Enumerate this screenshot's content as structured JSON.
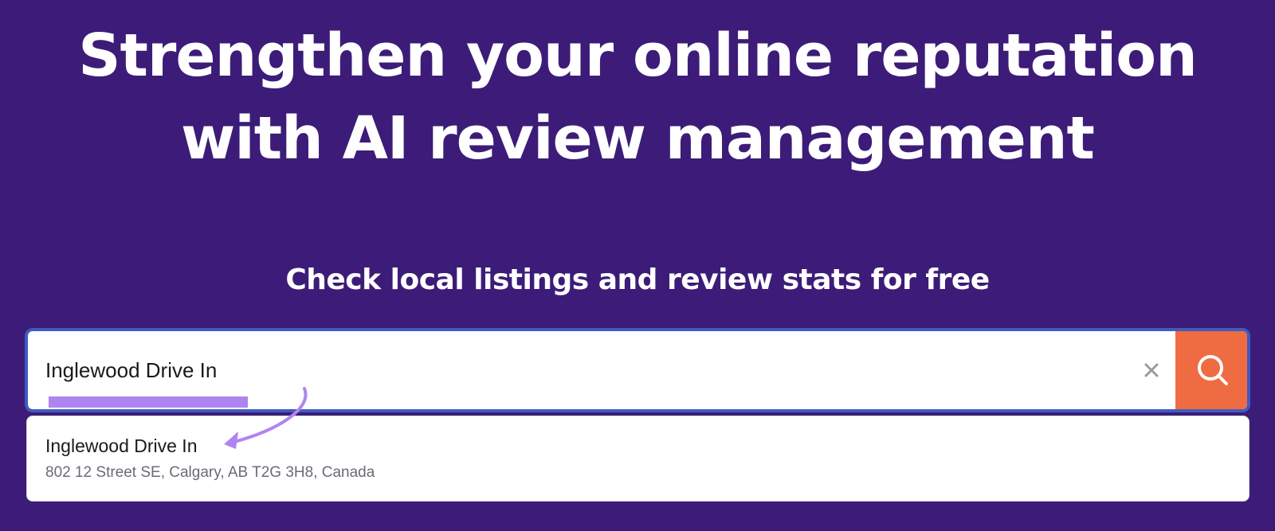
{
  "hero": {
    "headline_line1": "Strengthen your online reputation",
    "headline_line2": "with AI review management",
    "subheadline": "Check local listings and review stats for free"
  },
  "search": {
    "value": "Inglewood Drive In",
    "placeholder": "",
    "clear_icon": "close-icon",
    "submit_icon": "search-icon"
  },
  "suggestions": [
    {
      "name": "Inglewood Drive In",
      "address": "802 12 Street SE, Calgary, AB T2G 3H8, Canada"
    }
  ],
  "colors": {
    "background": "#3c1c78",
    "search_button": "#ef6c43",
    "search_border": "#3f5bbf",
    "highlight": "#b084f0"
  }
}
